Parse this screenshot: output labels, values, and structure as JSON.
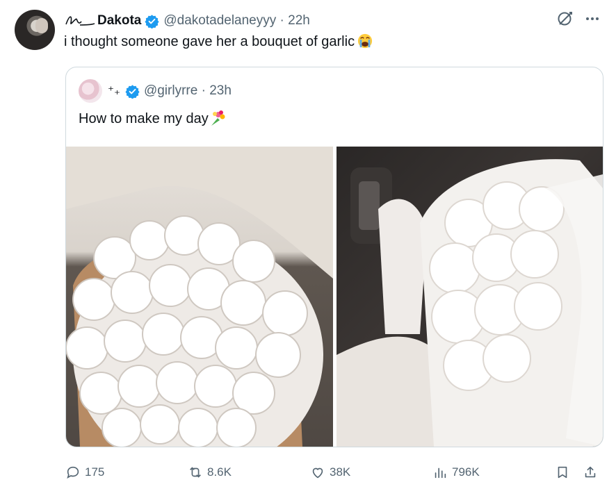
{
  "tweet": {
    "display_name": "Dakota",
    "handle": "@dakotadelaneyyy",
    "time": "22h",
    "text": "i thought someone gave her a bouquet of garlic",
    "emoji": "loudly-crying-face"
  },
  "quoted": {
    "handle": "@girlyrre",
    "time": "23h",
    "name_mark": "⁺₊",
    "text": "How to make my day",
    "emoji": "bouquet",
    "images": [
      {
        "name": "white-peony-bouquet-on-table"
      },
      {
        "name": "white-peony-bouquet-in-car"
      }
    ]
  },
  "metrics": {
    "replies": "175",
    "reposts": "8.6K",
    "likes": "38K",
    "views": "796K"
  },
  "colors": {
    "verified": "#1d9bf0",
    "muted": "#536471",
    "border": "#cfd9de"
  }
}
